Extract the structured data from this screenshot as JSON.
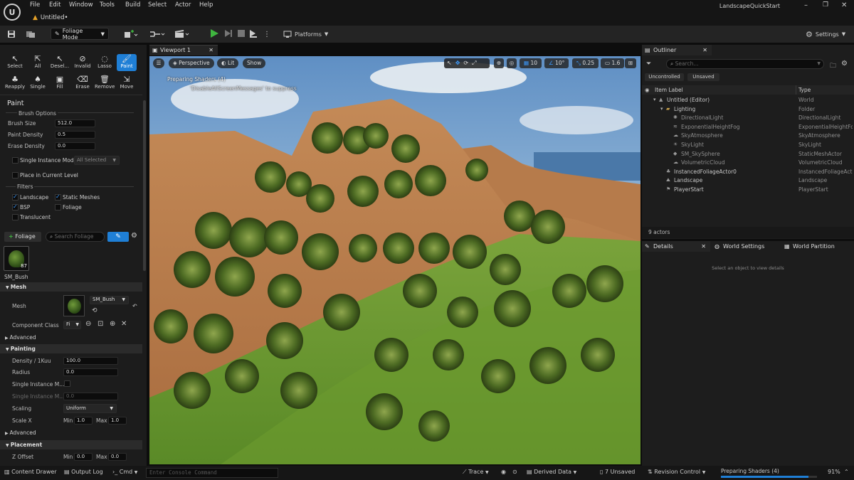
{
  "menubar": {
    "logo": "U",
    "items": [
      "File",
      "Edit",
      "Window",
      "Tools",
      "Build",
      "Select",
      "Actor",
      "Help"
    ],
    "doc_tab": "Untitled•",
    "project_name": "LandscapeQuickStart"
  },
  "toolbar": {
    "mode_label": "Foliage Mode",
    "platforms_label": "Platforms",
    "settings_label": "Settings"
  },
  "foliage_tools": [
    {
      "label": "Select",
      "icon": "cursor-icon"
    },
    {
      "label": "All",
      "icon": "all-icon"
    },
    {
      "label": "Desel...",
      "icon": "deselect-icon"
    },
    {
      "label": "Invalid",
      "icon": "invalid-icon"
    },
    {
      "label": "Lasso",
      "icon": "lasso-icon"
    },
    {
      "label": "Paint",
      "icon": "paint-brush-icon"
    },
    {
      "label": "Reapply",
      "icon": "reapply-icon"
    },
    {
      "label": "Single",
      "icon": "single-icon"
    },
    {
      "label": "Fill",
      "icon": "fill-icon"
    },
    {
      "label": "Erase",
      "icon": "erase-icon"
    },
    {
      "label": "Remove",
      "icon": "remove-icon"
    },
    {
      "label": "Move",
      "icon": "move-icon"
    }
  ],
  "paint": {
    "title": "Paint",
    "brush_options_header": "Brush Options",
    "brush_size_label": "Brush Size",
    "brush_size_value": "512.0",
    "paint_density_label": "Paint Density",
    "paint_density_value": "0.5",
    "erase_density_label": "Erase Density",
    "erase_density_value": "0.0",
    "single_instance_label": "Single Instance Mode:",
    "single_instance_value": "All Selected",
    "place_current_level_label": "Place in Current Level",
    "filters_header": "Filters",
    "filters": [
      {
        "label": "Landscape",
        "checked": true
      },
      {
        "label": "Static Meshes",
        "checked": true
      },
      {
        "label": "BSP",
        "checked": true
      },
      {
        "label": "Foliage",
        "checked": false
      },
      {
        "label": "Translucent",
        "checked": false
      }
    ],
    "add_foliage_label": "Foliage",
    "search_placeholder": "Search Foliage",
    "foliage_item_name": "SM_Bush",
    "foliage_item_count": "87"
  },
  "mesh_props": {
    "mesh_header": "Mesh",
    "mesh_label": "Mesh",
    "mesh_value": "SM_Bush",
    "component_class_label": "Component Class",
    "component_class_value": "Fi",
    "advanced_label": "Advanced",
    "painting_header": "Painting",
    "density_label": "Density / 1Kuu",
    "density_value": "100.0",
    "radius_label": "Radius",
    "radius_value": "0.0",
    "single_instance_label": "Single Instance M...",
    "single_instance_label_2": "Single Instance M...",
    "single_instance_value_2": "0.0",
    "scaling_label": "Scaling",
    "scaling_value": "Uniform",
    "scale_x_label": "Scale X",
    "min_label": "Min",
    "max_label": "Max",
    "scale_min": "1.0",
    "scale_max": "1.0",
    "advanced_label_2": "Advanced",
    "placement_header": "Placement",
    "z_offset_label": "Z Offset",
    "z_min": "0.0",
    "z_max": "0.0"
  },
  "viewport": {
    "tab_label": "Viewport 1",
    "perspective_label": "Perspective",
    "lit_label": "Lit",
    "show_label": "Show",
    "grid_value": "10",
    "angle_value": "10°",
    "scale_value": "0.25",
    "camera_speed": "1.6",
    "message_line_1": "Preparing Shaders (4)",
    "message_line_2": "'DisableAllScreenMessages' to suppress"
  },
  "outliner": {
    "tab_label": "Outliner",
    "search_placeholder": "Search...",
    "filter_uncontrolled": "Uncontrolled",
    "filter_unsaved": "Unsaved",
    "col_label": "Item Label",
    "col_type": "Type",
    "rows": [
      {
        "label": "Untitled (Editor)",
        "type": "World",
        "indent": 0,
        "icon": "world-icon"
      },
      {
        "label": "Lighting",
        "type": "Folder",
        "indent": 1,
        "icon": "folder-icon"
      },
      {
        "label": "DirectionalLight",
        "type": "DirectionalLight",
        "indent": 2,
        "icon": "light-icon"
      },
      {
        "label": "ExponentialHeightFog",
        "type": "ExponentialHeightFog",
        "indent": 2,
        "icon": "fog-icon"
      },
      {
        "label": "SkyAtmosphere",
        "type": "SkyAtmosphere",
        "indent": 2,
        "icon": "sky-icon"
      },
      {
        "label": "SkyLight",
        "type": "SkyLight",
        "indent": 2,
        "icon": "skylight-icon"
      },
      {
        "label": "SM_SkySphere",
        "type": "StaticMeshActor",
        "indent": 2,
        "icon": "mesh-icon"
      },
      {
        "label": "VolumetricCloud",
        "type": "VolumetricCloud",
        "indent": 2,
        "icon": "cloud-icon"
      },
      {
        "label": "InstancedFoliageActor0",
        "type": "InstancedFoliageActo",
        "indent": 1,
        "icon": "foliage-icon"
      },
      {
        "label": "Landscape",
        "type": "Landscape",
        "indent": 1,
        "icon": "landscape-icon"
      },
      {
        "label": "PlayerStart",
        "type": "PlayerStart",
        "indent": 1,
        "icon": "player-start-icon"
      }
    ],
    "actor_count": "9 actors"
  },
  "details": {
    "tab_label": "Details",
    "world_settings_label": "World Settings",
    "world_partition_label": "World Partition",
    "empty_message": "Select an object to view details"
  },
  "statusbar": {
    "content_drawer": "Content Drawer",
    "output_log": "Output Log",
    "cmd": "Cmd",
    "console_placeholder": "Enter Console Command",
    "trace": "Trace",
    "derived_data": "Derived Data",
    "unsaved": "7 Unsaved",
    "revision_control": "Revision Control",
    "shaders": "Preparing Shaders (4)",
    "shaders_percent": "91%",
    "shaders_progress": 0.91
  },
  "colors": {
    "accent": "#1f7fd6",
    "play_green": "#3fb53f",
    "panel": "#1c1c1c"
  }
}
